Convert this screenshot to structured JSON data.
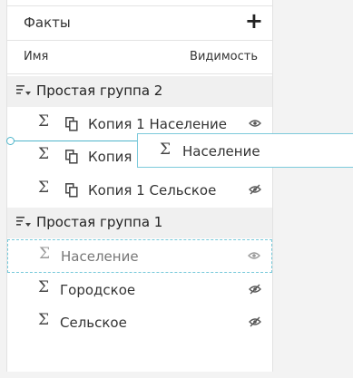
{
  "panel": {
    "title": "Факты",
    "add_label": "+",
    "columns": {
      "name": "Имя",
      "visibility": "Видимость"
    }
  },
  "groups": [
    {
      "label": "Простая группа 2",
      "items": [
        {
          "label": "Копия 1 Население",
          "visible": true
        },
        {
          "label": "Копия 1 Городское",
          "visible": true
        },
        {
          "label": "Копия 1 Сельское",
          "visible": false
        }
      ]
    },
    {
      "label": "Простая группа 1",
      "items": [
        {
          "label": "Население",
          "visible": true,
          "placeholder": true
        },
        {
          "label": "Городское",
          "visible": false
        },
        {
          "label": "Сельское",
          "visible": false
        }
      ]
    }
  ],
  "drag_item": {
    "label": "Население"
  },
  "icons": {
    "sigma": "Σ",
    "group": "group-sort-icon",
    "copy": "copy-icon",
    "eye": "eye-icon",
    "eye_hidden": "eye-slash-icon"
  },
  "colors": {
    "accent": "#4fb5ca",
    "group_bg": "#f0f0f0"
  }
}
